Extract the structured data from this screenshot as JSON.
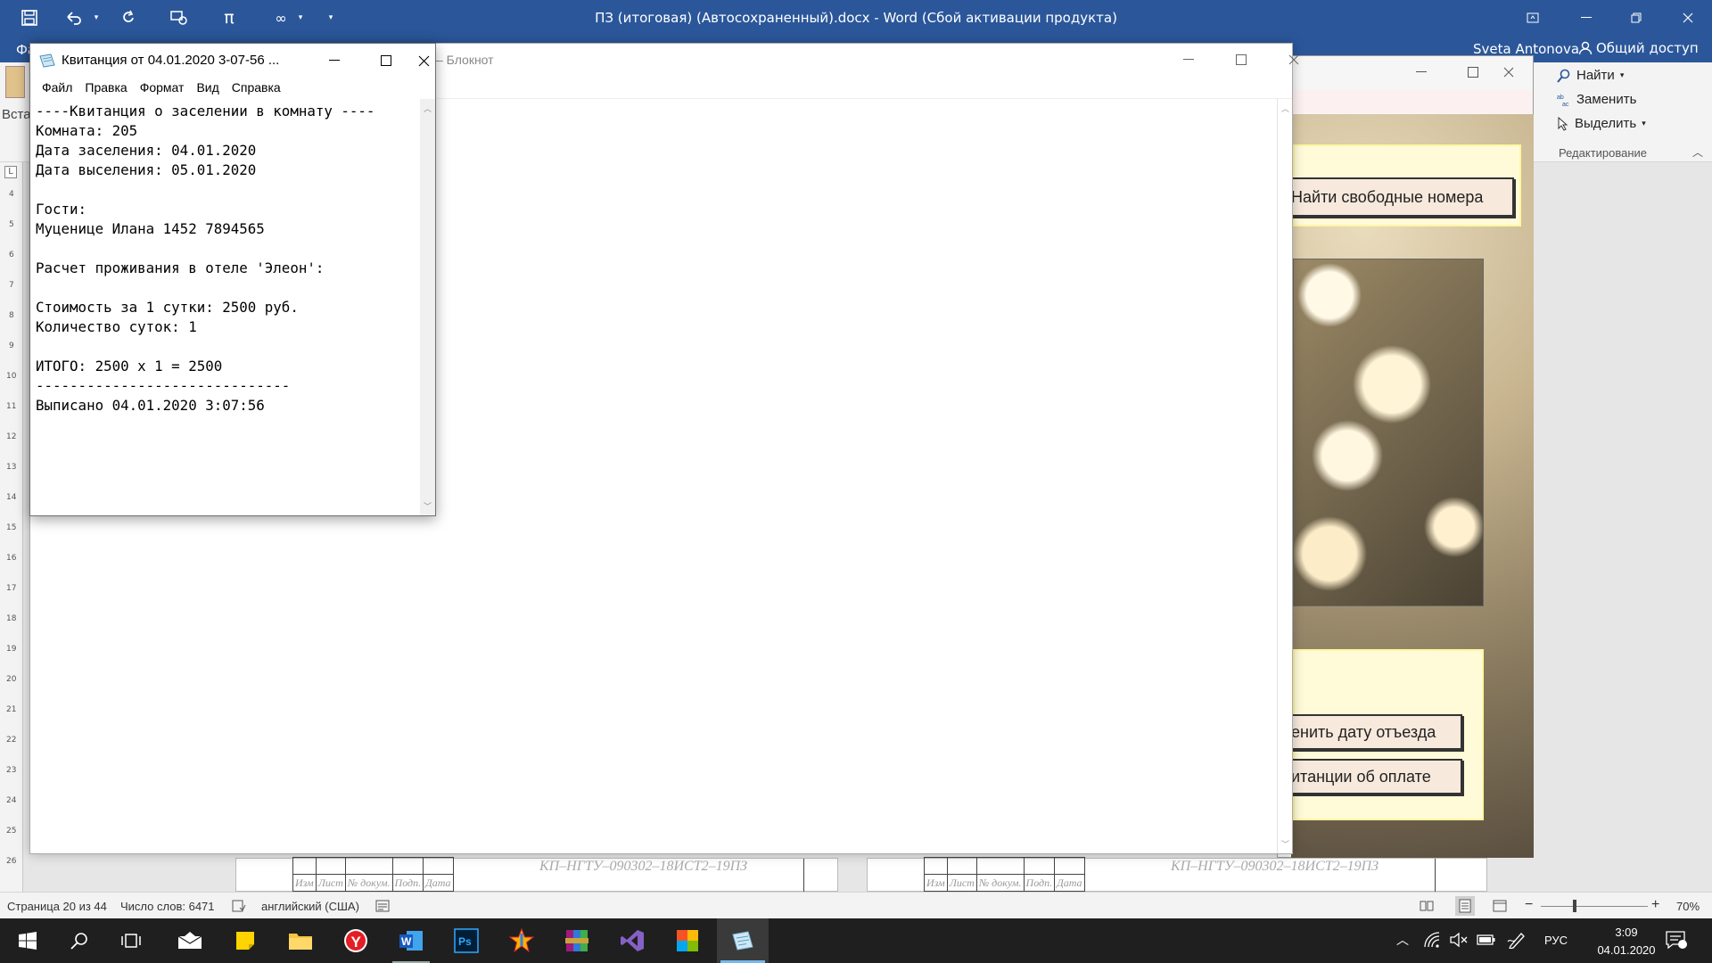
{
  "word": {
    "title": "ПЗ (итоговая) (Автосохраненный).docx - Word (Сбой активации продукта)",
    "user": "Sveta Antonova",
    "share": "Общий доступ",
    "ribbon": {
      "find": "Найти",
      "replace": "Заменить",
      "select": "Выделить",
      "group_label": "Редактирование",
      "tab_fragment": "Фа",
      "paste_fragment": "Вста"
    },
    "stamp": {
      "headers": [
        "Изм",
        "Лист",
        "№ докум.",
        "Подп.",
        "Дата"
      ],
      "code": "КП–НГТУ–090302–18ИСТ2–19ПЗ"
    },
    "status": {
      "page": "Страница 20 из 44",
      "words": "Число слов: 6471",
      "language": "английский (США)",
      "zoom": "70%"
    }
  },
  "hotel_app": {
    "find_rooms": "Найти свободные номера",
    "change_date": "енить дату отъезда",
    "receipt": "итанции об оплате"
  },
  "notepad_back": {
    "title": "– Блокнот"
  },
  "notepad": {
    "title": "Квитанция от 04.01.2020 3-07-56 ...",
    "menu": [
      "Файл",
      "Правка",
      "Формат",
      "Вид",
      "Справка"
    ],
    "lines": [
      "----Квитанция о заселении в комнату ----",
      "Комната: 205",
      "Дата заселения: 04.01.2020",
      "Дата выселения: 05.01.2020",
      "",
      "Гости:",
      "Муценице Илана 1452 7894565",
      "",
      "Расчет проживания в отеле 'Элеон':",
      "",
      "Стоимость за 1 сутки: 2500 руб.",
      "Количество суток: 1",
      "",
      "ИТОГО: 2500 x 1 = 2500",
      "------------------------------",
      "Выписано 04.01.2020 3:07:56"
    ]
  },
  "taskbar": {
    "lang": "РУС",
    "time": "3:09",
    "date": "04.01.2020",
    "apps": [
      "start",
      "search",
      "task-view",
      "mail",
      "sticky-notes",
      "file-explorer",
      "yandex-browser",
      "word",
      "photoshop",
      "star-app",
      "winrar",
      "visual-studio",
      "app-tiles",
      "notepad"
    ],
    "colors": {
      "taskbar": "#1f1f1f",
      "accent": "#76b9ed",
      "word_blue": "#2b579a"
    }
  }
}
